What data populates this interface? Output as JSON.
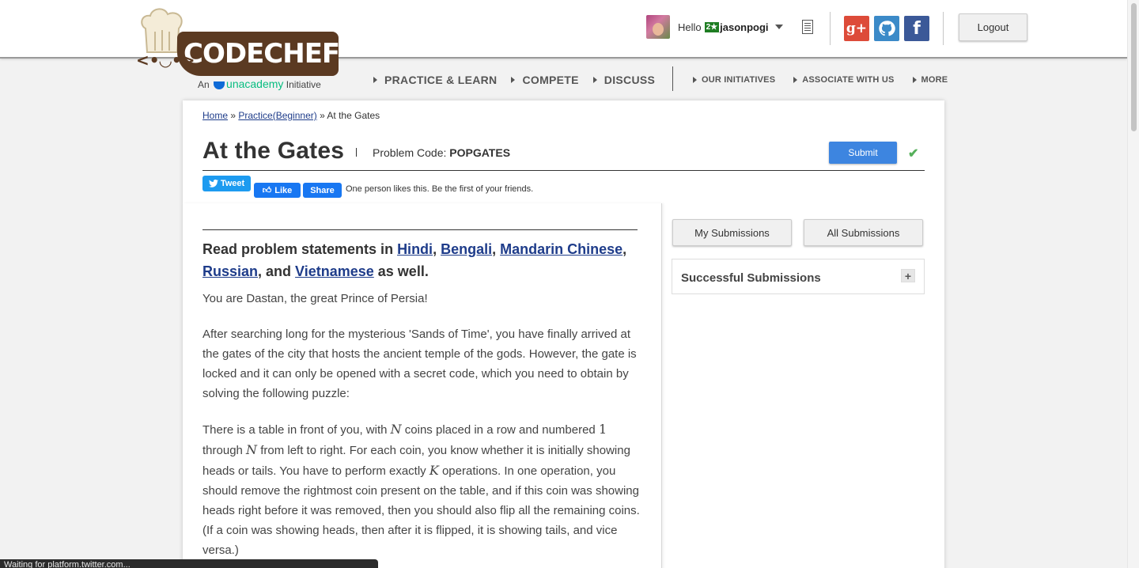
{
  "header": {
    "logo_text": "CODECHEF",
    "logo_tagline_prefix": "An",
    "logo_tagline_brand": "unacademy",
    "logo_tagline_suffix": "Initiative",
    "hello": "Hello",
    "star_badge": "2★",
    "username": "jasonpogi",
    "logout_label": "Logout",
    "social": [
      {
        "name": "google-plus",
        "glyph": "g+"
      },
      {
        "name": "github",
        "glyph": ""
      },
      {
        "name": "facebook",
        "glyph": "f"
      }
    ]
  },
  "nav": {
    "main": [
      "PRACTICE & LEARN",
      "COMPETE",
      "DISCUSS"
    ],
    "minor": [
      "OUR INITIATIVES",
      "ASSOCIATE WITH US",
      "MORE"
    ]
  },
  "breadcrumb": {
    "home": "Home",
    "sep1": " » ",
    "practice": "Practice(Beginner)",
    "sep2": " » ",
    "current": "At the Gates"
  },
  "problem": {
    "title": "At the Gates",
    "code_label": "Problem Code: ",
    "code": "POPGATES",
    "submit_label": "Submit",
    "check_glyph": "✔",
    "share": {
      "tweet": "Tweet",
      "like": "Like",
      "share": "Share",
      "likes_text": "One person likes this. Be the first of your friends."
    },
    "lead_prefix": "Read problem statements in ",
    "languages": [
      "Hindi",
      "Bengali",
      "Mandarin Chinese",
      "Russian",
      "Vietnamese"
    ],
    "lead_suffix": " as well.",
    "p1": "You are Dastan, the great Prince of Persia!",
    "p2": "After searching long for the mysterious 'Sands of Time', you have finally arrived at the gates of the city that hosts the ancient temple of the gods. However, the gate is locked and it can only be opened with a secret code, which you need to obtain by solving the following puzzle:",
    "p3_a": "There is a table in front of you, with ",
    "p3_N": "N",
    "p3_b": " coins placed in a row and numbered ",
    "p3_one": "1",
    "p3_c": " through ",
    "p3_N2": "N",
    "p3_d": " from left to right. For each coin, you know whether it is initially showing heads or tails. You have to perform exactly ",
    "p3_K": "K",
    "p3_e": " operations. In one operation, you should remove the rightmost coin present on the table, and if this coin was showing heads right before it was removed, then you should also flip all the remaining coins. (If a coin was showing heads, then after it is flipped, it is showing tails, and vice versa.)"
  },
  "sidebar": {
    "my_submissions": "My Submissions",
    "all_submissions": "All Submissions",
    "successful_submissions": "Successful Submissions",
    "expand_glyph": "+"
  },
  "statusbar": {
    "text": "Waiting for platform.twitter.com..."
  },
  "colors": {
    "brand_brown": "#5b3a22",
    "submit_blue": "#3d85e0",
    "link_blue": "#1e3c8a",
    "success_green": "#56b05b"
  }
}
